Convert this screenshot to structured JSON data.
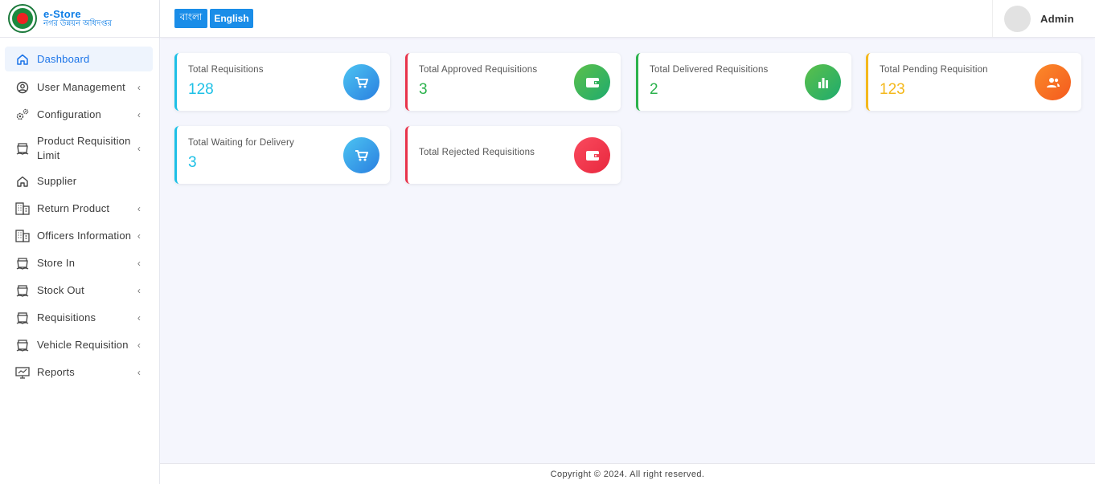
{
  "brand": {
    "title": "e-Store",
    "subtitle": "নগর উন্নয়ন অধিদপ্তর"
  },
  "sidebar": {
    "items": [
      {
        "label": "Dashboard",
        "icon": "home-icon",
        "active": true,
        "has_submenu": false
      },
      {
        "label": "User Management",
        "icon": "user-circle-icon",
        "has_submenu": true
      },
      {
        "label": "Configuration",
        "icon": "gears-icon",
        "has_submenu": true
      },
      {
        "label": "Product Requisition Limit",
        "icon": "bag-icon",
        "has_submenu": true
      },
      {
        "label": "Supplier",
        "icon": "home-icon",
        "has_submenu": false
      },
      {
        "label": "Return Product",
        "icon": "building-icon",
        "has_submenu": true
      },
      {
        "label": "Officers Information",
        "icon": "building-icon",
        "has_submenu": true
      },
      {
        "label": "Store In",
        "icon": "bag-icon",
        "has_submenu": true
      },
      {
        "label": "Stock Out",
        "icon": "bag-icon",
        "has_submenu": true
      },
      {
        "label": "Requisitions",
        "icon": "bag-icon",
        "has_submenu": true
      },
      {
        "label": "Vehicle Requisition",
        "icon": "bag-icon",
        "has_submenu": true
      },
      {
        "label": "Reports",
        "icon": "monitor-icon",
        "has_submenu": true
      }
    ]
  },
  "header": {
    "lang_bn": "বাংলা",
    "lang_en": "English",
    "user_name": "Admin"
  },
  "cards": [
    {
      "label": "Total Requisitions",
      "value": "128",
      "color": "#1ec0e6",
      "icon": "cart-icon"
    },
    {
      "label": "Total Approved Requisitions",
      "value": "3",
      "color": "#e8334b",
      "value_color": "#2bb24c",
      "icon": "wallet-icon"
    },
    {
      "label": "Total Delivered Requisitions",
      "value": "2",
      "color": "#2bb24c",
      "icon": "bar-chart-icon"
    },
    {
      "label": "Total Pending Requisition",
      "value": "123",
      "color": "#f4b81c",
      "icon": "users-icon"
    },
    {
      "label": "Total Waiting for Delivery",
      "value": "3",
      "color": "#1ec0e6",
      "icon": "cart-icon"
    },
    {
      "label": "Total Rejected Requisitions",
      "value": "",
      "color": "#e8334b",
      "icon": "wallet-icon"
    }
  ],
  "footer": {
    "text": "Copyright © 2024. All right reserved."
  },
  "colors": {
    "accent": "#1a8de8",
    "background": "#f5f6fd"
  }
}
